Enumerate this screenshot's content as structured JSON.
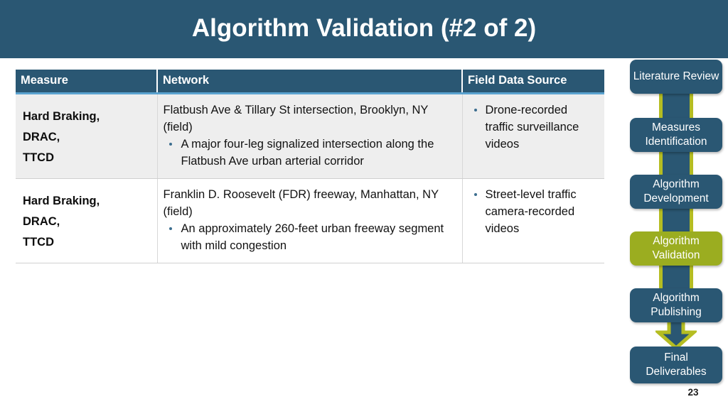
{
  "slide": {
    "title": "Algorithm Validation (#2 of 2)",
    "page_number": "23",
    "colors": {
      "header_blue": "#2a5773",
      "accent_light_blue": "#5ba3d0",
      "highlight_olive": "#9bad20",
      "connector_olive": "#b5bd22",
      "row_alt_gray": "#eeeeee"
    }
  },
  "table": {
    "headers": {
      "measure": "Measure",
      "network": "Network",
      "field_data_source": "Field Data Source"
    },
    "rows": [
      {
        "measure_lines": [
          "Hard Braking,",
          "DRAC,",
          "TTCD"
        ],
        "network_lead": "Flatbush Ave & Tillary St intersection, Brooklyn, NY (field)",
        "network_bullets": [
          "A major four-leg signalized intersection along the Flatbush Ave urban arterial corridor"
        ],
        "field_bullets": [
          "Drone-recorded traffic surveillance videos"
        ]
      },
      {
        "measure_lines": [
          "Hard Braking,",
          "DRAC,",
          "TTCD"
        ],
        "network_lead": "Franklin D. Roosevelt (FDR) freeway, Manhattan, NY (field)",
        "network_bullets": [
          "An approximately 260-feet urban freeway segment with mild congestion"
        ],
        "field_bullets": [
          "Street-level traffic camera-recorded videos"
        ]
      }
    ]
  },
  "flowchart": {
    "steps": [
      {
        "label": "Literature Review",
        "highlighted": false
      },
      {
        "label": "Measures Identification",
        "highlighted": false
      },
      {
        "label": "Algorithm Development",
        "highlighted": false
      },
      {
        "label": "Algorithm Validation",
        "highlighted": true
      },
      {
        "label": "Algorithm Publishing",
        "highlighted": false
      },
      {
        "label": "Final Deliverables",
        "highlighted": false
      }
    ]
  }
}
